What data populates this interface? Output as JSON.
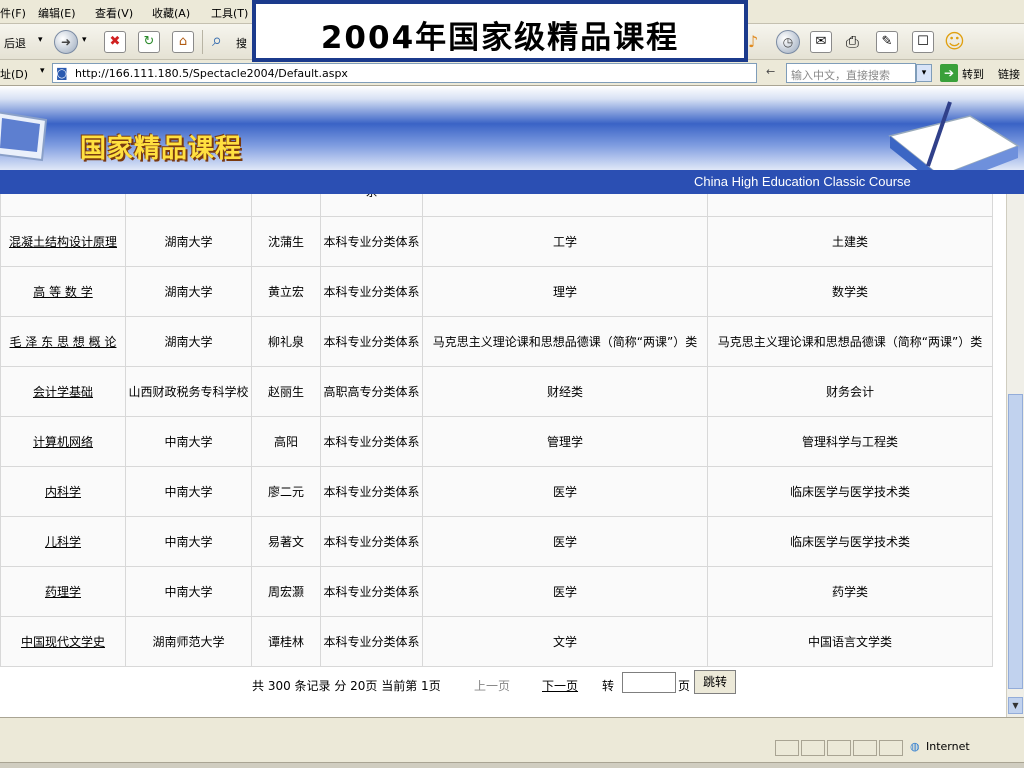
{
  "overlay": {
    "title": "2004年国家级精品课程"
  },
  "menu": [
    "件(F)",
    "编辑(E)",
    "查看(V)",
    "收藏(A)",
    "工具(T)"
  ],
  "toolbar": {
    "back_label": "后退",
    "search_label": "搜"
  },
  "address": {
    "label": "址(D)",
    "url": "http://166.111.180.5/Spectacle2004/Default.aspx",
    "search_placeholder": "输入中文，直接搜索",
    "go_label": "转到",
    "links_label": "链接"
  },
  "banner": {
    "title": "国家精品课程",
    "caption": "China High Education Classic Course"
  },
  "table": {
    "partial_row": [
      "",
      "",
      "",
      "系",
      "",
      ""
    ],
    "rows": [
      [
        "混凝土结构设计原理",
        "湖南大学",
        "沈蒲生",
        "本科专业分类体系",
        "工学",
        "土建类"
      ],
      [
        "高 等 数 学",
        "湖南大学",
        "黄立宏",
        "本科专业分类体系",
        "理学",
        "数学类"
      ],
      [
        "毛 泽 东 思 想 概 论",
        "湖南大学",
        "柳礼泉",
        "本科专业分类体系",
        "马克思主义理论课和思想品德课（简称“两课”）类",
        "马克思主义理论课和思想品德课（简称“两课”）类"
      ],
      [
        "会计学基础",
        "山西财政税务专科学校",
        "赵丽生",
        "高职高专分类体系",
        "财经类",
        "财务会计"
      ],
      [
        "计算机网络",
        "中南大学",
        "高阳",
        "本科专业分类体系",
        "管理学",
        "管理科学与工程类"
      ],
      [
        "内科学",
        "中南大学",
        "廖二元",
        "本科专业分类体系",
        "医学",
        "临床医学与医学技术类"
      ],
      [
        "儿科学",
        "中南大学",
        "易著文",
        "本科专业分类体系",
        "医学",
        "临床医学与医学技术类"
      ],
      [
        "药理学",
        "中南大学",
        "周宏灏",
        "本科专业分类体系",
        "医学",
        "药学类"
      ],
      [
        "中国现代文学史",
        "湖南师范大学",
        "谭桂林",
        "本科专业分类体系",
        "文学",
        "中国语言文学类"
      ]
    ]
  },
  "pager": {
    "summary": "共 300 条记录 分 20页 当前第 1页",
    "prev": "上一页",
    "next": "下一页",
    "goto": "转",
    "page_unit": "页",
    "jump_button": "跳转"
  },
  "status": {
    "zone": "Internet"
  }
}
